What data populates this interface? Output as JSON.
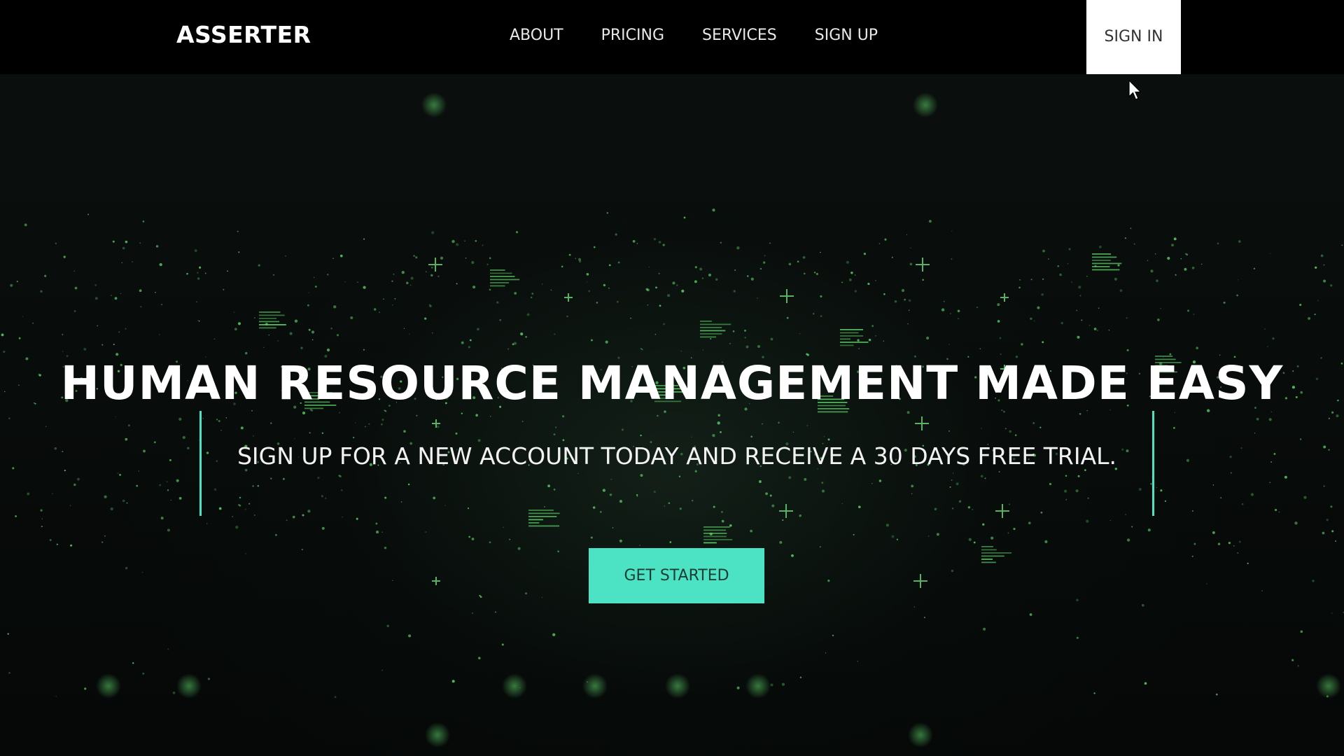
{
  "header": {
    "logo": "ASSERTER",
    "nav": [
      {
        "label": "ABOUT"
      },
      {
        "label": "PRICING"
      },
      {
        "label": "SERVICES"
      },
      {
        "label": "SIGN UP"
      }
    ],
    "signin_label": "SIGN IN"
  },
  "hero": {
    "title": "HUMAN RESOURCE MANAGEMENT MADE EASY",
    "subtitle": "SIGN UP FOR A NEW ACCOUNT TODAY AND RECEIVE A 30 DAYS FREE TRIAL.",
    "cta_label": "GET STARTED"
  },
  "colors": {
    "accent": "#4ce3c4",
    "background": "#060908",
    "navbar": "#000000",
    "signin_bg": "#ffffff",
    "particles": "#5fd46a"
  },
  "icons": {
    "cursor": "mouse-pointer-icon"
  }
}
